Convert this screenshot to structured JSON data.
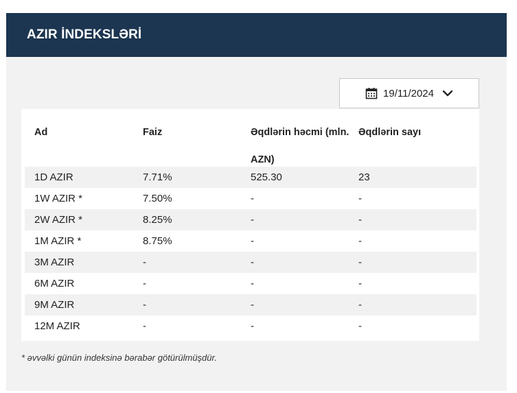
{
  "header": {
    "title": "AZIR İNDEKSLƏRİ"
  },
  "date_picker": {
    "value": "19/11/2024",
    "icon": "calendar-icon",
    "chevron": "chevron-down-icon"
  },
  "table": {
    "columns": [
      "Ad",
      "Faiz",
      "Əqdlərin həcmi (mln. AZN)",
      "Əqdlərin sayı"
    ],
    "rows": [
      [
        "1D AZIR",
        "7.71%",
        "525.30",
        "23"
      ],
      [
        "1W AZIR *",
        "7.50%",
        "-",
        "-"
      ],
      [
        "2W AZIR *",
        "8.25%",
        "-",
        "-"
      ],
      [
        "1M AZIR *",
        "8.75%",
        "-",
        "-"
      ],
      [
        "3M AZIR",
        "-",
        "-",
        "-"
      ],
      [
        "6M AZIR",
        "-",
        "-",
        "-"
      ],
      [
        "9M AZIR",
        "-",
        "-",
        "-"
      ],
      [
        "12M AZIR",
        "-",
        "-",
        "-"
      ]
    ]
  },
  "footnote": "* əvvəlki günün indeksinə bərabər götürülmüşdür.",
  "colors": {
    "header_bg": "#1c3550",
    "panel_bg": "#f2f2f2",
    "stripe": "#f1f1f1"
  }
}
